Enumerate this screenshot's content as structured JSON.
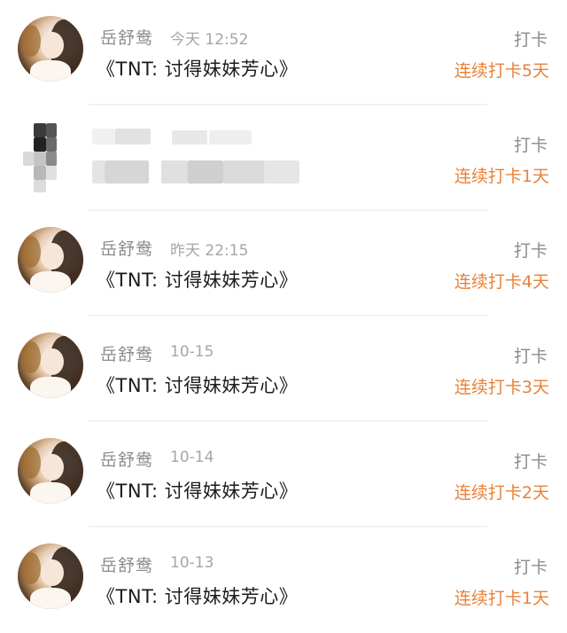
{
  "rows": [
    {
      "name": "岳舒鸯",
      "time": "今天 12:52",
      "book": "《TNT: 讨得妹妹芳心》",
      "action": "打卡",
      "streak": "连续打卡5天"
    },
    {
      "name": "",
      "time": "",
      "book": "",
      "action": "打卡",
      "streak": "连续打卡1天",
      "blurred": true
    },
    {
      "name": "岳舒鸯",
      "time": "昨天 22:15",
      "book": "《TNT: 讨得妹妹芳心》",
      "action": "打卡",
      "streak": "连续打卡4天"
    },
    {
      "name": "岳舒鸯",
      "time": "10-15",
      "book": "《TNT: 讨得妹妹芳心》",
      "action": "打卡",
      "streak": "连续打卡3天"
    },
    {
      "name": "岳舒鸯",
      "time": "10-14",
      "book": "《TNT: 讨得妹妹芳心》",
      "action": "打卡",
      "streak": "连续打卡2天"
    },
    {
      "name": "岳舒鸯",
      "time": "10-13",
      "book": "《TNT: 讨得妹妹芳心》",
      "action": "打卡",
      "streak": "连续打卡1天"
    }
  ],
  "colors": {
    "streak": "#e8823b",
    "muted": "#8c8c8c",
    "text": "#1b1b1b"
  }
}
